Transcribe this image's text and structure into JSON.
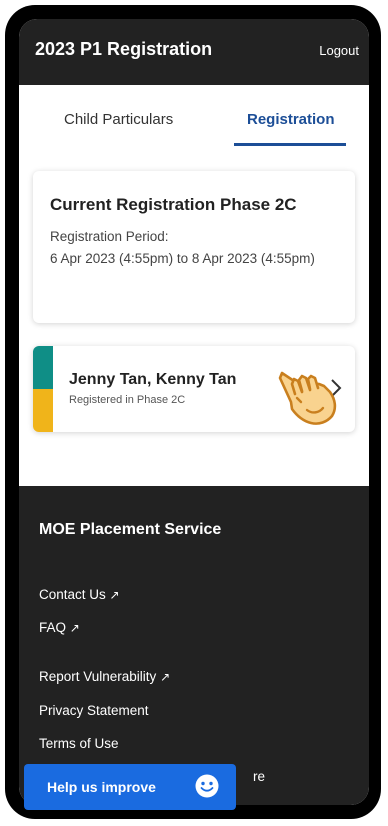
{
  "header": {
    "title": "2023 P1 Registration",
    "logout_label": "Logout"
  },
  "tabs": [
    {
      "label": "Child Particulars",
      "active": false
    },
    {
      "label": "Registration",
      "active": true
    }
  ],
  "phase_card": {
    "title": "Current Registration Phase 2C",
    "period_label": "Registration Period:",
    "period_value": "6 Apr 2023 (4:55pm) to 8 Apr 2023 (4:55pm)"
  },
  "child_card": {
    "names": "Jenny Tan, Kenny Tan",
    "status": "Registered in Phase 2C",
    "stripe_colors": [
      "#0f8e86",
      "#f0b41a"
    ]
  },
  "footer": {
    "title": "MOE Placement Service",
    "links": [
      {
        "label": "Contact Us",
        "external": true
      },
      {
        "label": "FAQ",
        "external": true
      },
      {
        "label": "Report Vulnerability",
        "external": true
      },
      {
        "label": "Privacy Statement",
        "external": false
      },
      {
        "label": "Terms of Use",
        "external": false
      }
    ],
    "partial_text": "re",
    "external_arrow": "↗"
  },
  "help_button": {
    "label": "Help us improve"
  },
  "colors": {
    "header_bg": "#222222",
    "accent": "#1c4e97",
    "help_button": "#1a6be0"
  }
}
